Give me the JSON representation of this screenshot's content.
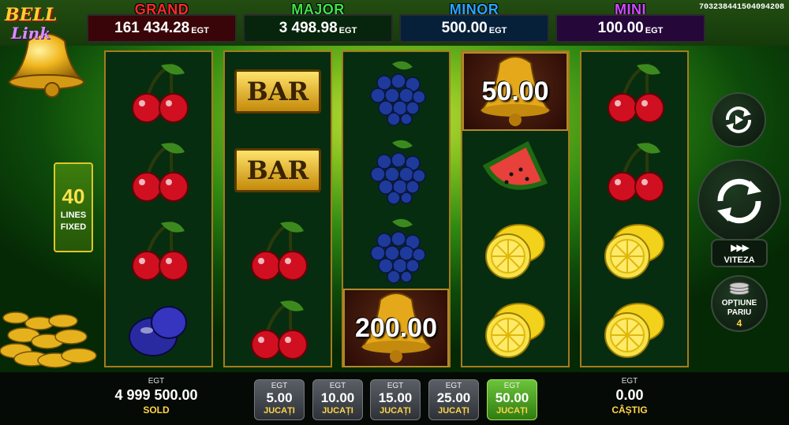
{
  "game": {
    "id_code": "703238441504094208"
  },
  "logo": {
    "word1": "BELL",
    "word2": "Link"
  },
  "jackpots": [
    {
      "name": "GRAND",
      "value": "161 434.28",
      "currency": "EGT",
      "label_color": "#ff2a2a",
      "box_color": "#3a0508"
    },
    {
      "name": "MAJOR",
      "value": "3 498.98",
      "currency": "EGT",
      "label_color": "#3ee04a",
      "box_color": "#07240c"
    },
    {
      "name": "MINOR",
      "value": "500.00",
      "currency": "EGT",
      "label_color": "#2aa4ff",
      "box_color": "#06203a"
    },
    {
      "name": "MINI",
      "value": "100.00",
      "currency": "EGT",
      "label_color": "#d04aff",
      "box_color": "#25073a"
    }
  ],
  "lines": {
    "count": "40",
    "line1": "LINES",
    "line2": "FIXED"
  },
  "reels": [
    [
      "cherry",
      "cherry",
      "cherry",
      "plum"
    ],
    [
      "bar",
      "bar",
      "cherry",
      "cherry"
    ],
    [
      "grapes",
      "grapes",
      "grapes",
      "bell"
    ],
    [
      "bell",
      "watermelon",
      "lemon",
      "lemon"
    ],
    [
      "cherry",
      "cherry",
      "lemon",
      "lemon"
    ]
  ],
  "bell_values": {
    "reel3_row4": "200.00",
    "reel4_row1": "50.00"
  },
  "bar_label": "BAR",
  "controls": {
    "autoplay_icon": "autoplay-icon",
    "spin_icon": "spin-icon",
    "speed_label": "VITEZA",
    "bet_option_line1": "OPȚIUNE",
    "bet_option_line2": "PARIU",
    "bet_option_value": "4"
  },
  "balance": {
    "currency": "EGT",
    "value": "4 999 500.00",
    "label": "SOLD"
  },
  "win": {
    "currency": "EGT",
    "value": "0.00",
    "label": "CÂȘTIG"
  },
  "bets": [
    {
      "currency": "EGT",
      "value": "5.00",
      "label": "JUCAȚI",
      "active": false
    },
    {
      "currency": "EGT",
      "value": "10.00",
      "label": "JUCAȚI",
      "active": false
    },
    {
      "currency": "EGT",
      "value": "15.00",
      "label": "JUCAȚI",
      "active": false
    },
    {
      "currency": "EGT",
      "value": "25.00",
      "label": "JUCAȚI",
      "active": false
    },
    {
      "currency": "EGT",
      "value": "50.00",
      "label": "JUCAȚI",
      "active": true
    }
  ]
}
